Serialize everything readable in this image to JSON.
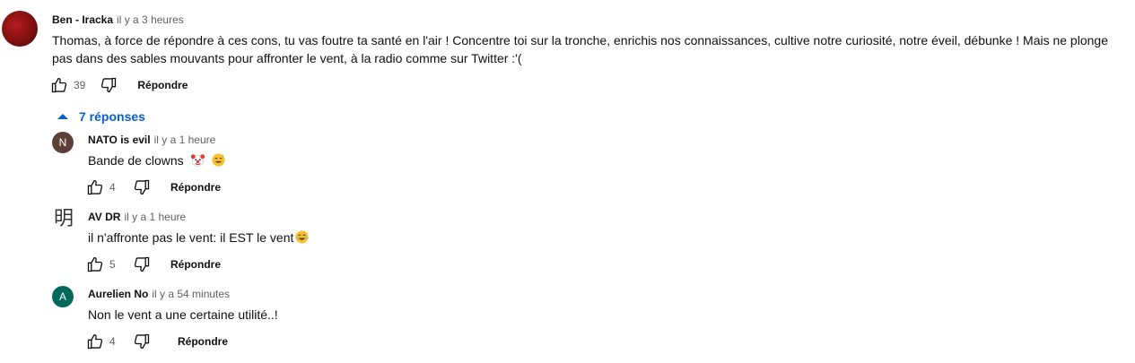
{
  "thread": {
    "author": "Ben - Iracka",
    "time": "il y a 3 heures",
    "text": "Thomas, à force de répondre à ces cons, tu vas foutre ta santé en l'air ! Concentre toi sur la tronche, enrichis nos connaissances, cultive notre curiosité, notre éveil, débunke ! Mais ne plonge pas dans des sables mouvants pour affronter le vent, à la radio comme sur Twitter :'(",
    "likes": "39",
    "reply_label": "Répondre",
    "replies_toggle": "7 réponses"
  },
  "replies": [
    {
      "avatar_letter": "N",
      "avatar_color": "#5d4037",
      "author": "NATO is evil",
      "time": "il y a 1 heure",
      "text": "Bande de clowns",
      "emojis": [
        "clown-face",
        "grinning-sweat"
      ],
      "likes": "4",
      "reply_label": "Répondre"
    },
    {
      "avatar_glyph": "明",
      "author": "AV DR",
      "time": "il y a 1 heure",
      "text": "il n'affronte pas le vent: il EST le vent",
      "emojis": [
        "tears-of-joy"
      ],
      "likes": "5",
      "reply_label": "Répondre"
    },
    {
      "avatar_letter": "A",
      "avatar_color": "#00695c",
      "author": "Aurelien No",
      "time": "il y a 54 minutes",
      "text": "Non le vent a une certaine utilité..!",
      "likes": "4",
      "reply_label": "Répondre"
    }
  ],
  "colors": {
    "link": "#065fd4",
    "secondary_text": "#606060"
  }
}
